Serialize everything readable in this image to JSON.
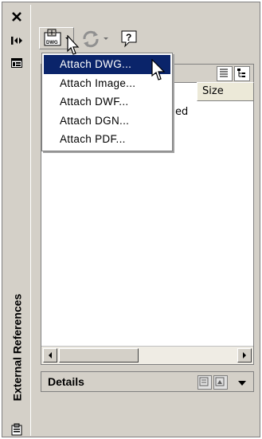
{
  "palette": {
    "title": "External References",
    "toolbar": {
      "attach_icon_label": "DWG"
    },
    "list": {
      "columns": [
        "Size"
      ],
      "partial_status_text": "ed"
    },
    "details": {
      "title": "Details"
    },
    "attach_menu": {
      "items": [
        {
          "label": "Attach DWG...",
          "selected": true
        },
        {
          "label": "Attach Image...",
          "selected": false
        },
        {
          "label": "Attach DWF...",
          "selected": false
        },
        {
          "label": "Attach DGN...",
          "selected": false
        },
        {
          "label": "Attach PDF...",
          "selected": false
        }
      ]
    }
  },
  "colors": {
    "selection": "#0a246a",
    "chrome": "#d4d0c8"
  }
}
